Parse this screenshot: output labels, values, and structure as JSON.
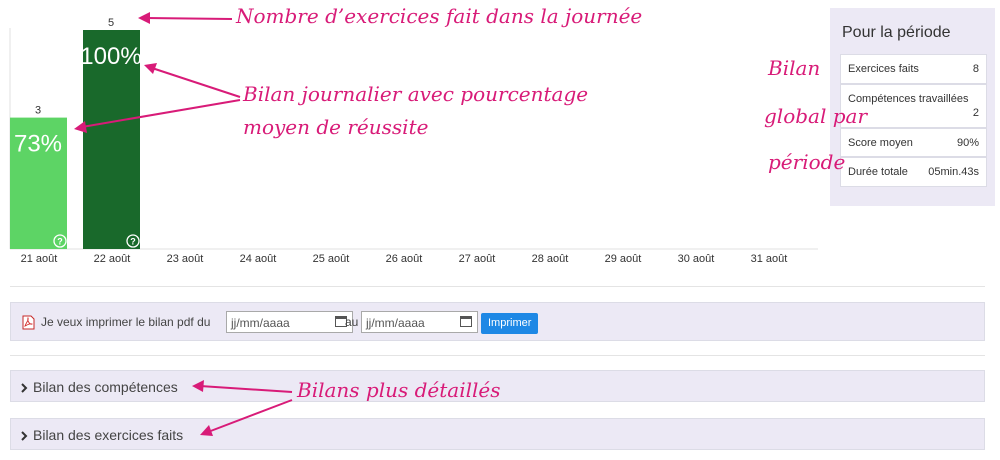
{
  "chart_data": {
    "type": "bar",
    "categories": [
      "21 août",
      "22 août",
      "23 août",
      "24 août",
      "25 août",
      "26 août",
      "27 août",
      "28 août",
      "29 août",
      "30 août",
      "31 août"
    ],
    "series": [
      {
        "counts": [
          3,
          5,
          null,
          null,
          null,
          null,
          null,
          null,
          null,
          null,
          null
        ],
        "percent_labels": [
          "73%",
          "100%",
          "",
          "",
          "",
          "",
          "",
          "",
          "",
          "",
          ""
        ],
        "colors": [
          "#5dd465",
          "#19692b"
        ]
      }
    ],
    "ylim": [
      0,
      5
    ]
  },
  "summary": {
    "title": "Pour la période",
    "rows": [
      {
        "label": "Exercices faits",
        "value": "8"
      },
      {
        "label": "Compétences travaillées",
        "value": "2"
      },
      {
        "label": "Score moyen",
        "value": "90%"
      },
      {
        "label": "Durée totale",
        "value": "05min.43s"
      }
    ]
  },
  "print": {
    "label": "Je veux imprimer le bilan pdf du",
    "from_placeholder": "jj/mm/aaaa",
    "to_label": "au",
    "to_placeholder": "jj/mm/aaaa",
    "button": "Imprimer"
  },
  "sections": [
    {
      "label": "Bilan des compétences"
    },
    {
      "label": "Bilan des exercices faits"
    }
  ],
  "annotations": {
    "count": "Nombre d’exercices fait dans la journée",
    "daily_1": "Bilan journalier avec pourcentage",
    "daily_2": "moyen de réussite",
    "global_1": "Bilan",
    "global_2": "global par",
    "global_3": "période",
    "detailed": "Bilans plus détaillés"
  },
  "colors": {
    "accent": "#d81b78",
    "button": "#1e88e5",
    "panel": "#ece9f5"
  }
}
